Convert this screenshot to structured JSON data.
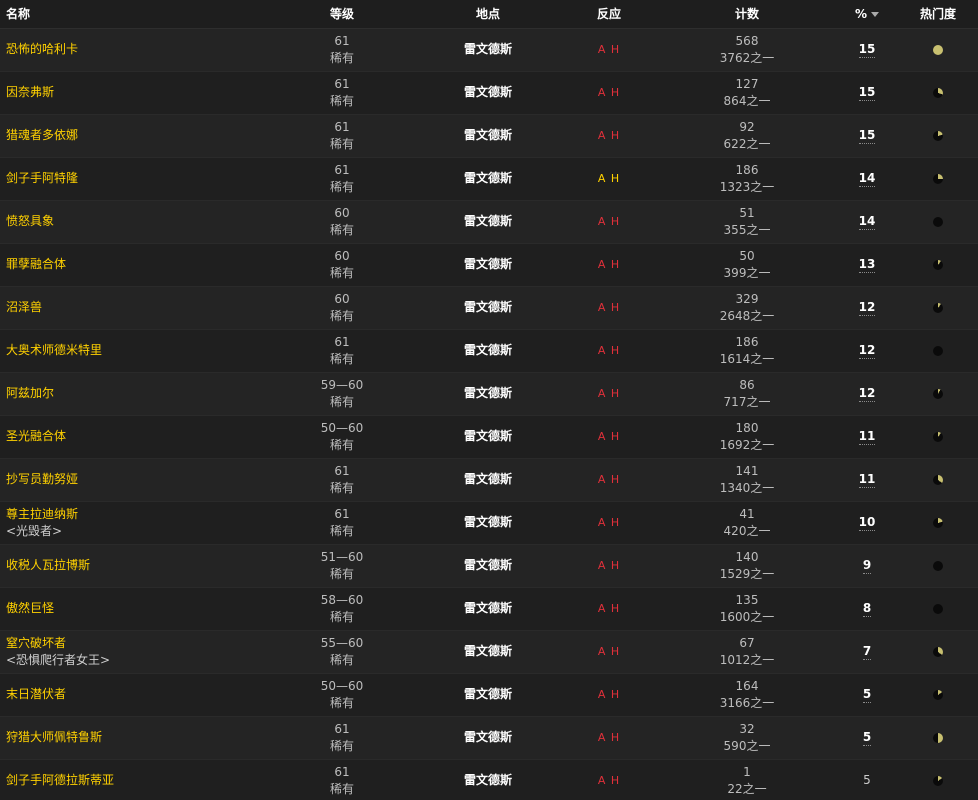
{
  "headers": {
    "name": "名称",
    "level": "等级",
    "location": "地点",
    "reaction": "反应",
    "count": "计数",
    "percent": "%",
    "popularity": "热门度"
  },
  "colors": {
    "name": "#ffd100",
    "reaction_hostile": "#e0303a",
    "reaction_neutral": "#ffd100",
    "pie_fill": "#c8c070",
    "pie_bg": "#0a0a0a"
  },
  "rows": [
    {
      "name": "恐怖的哈利卡",
      "title": "",
      "level": "61",
      "classification": "稀有",
      "location": "雷文德斯",
      "reaction": "A H",
      "reaction_color": "#e0303a",
      "count": "568",
      "total": "3762之一",
      "percent": "15",
      "percent_style": "dotted",
      "popularity": 1.0
    },
    {
      "name": "因奈弗斯",
      "title": "",
      "level": "61",
      "classification": "稀有",
      "location": "雷文德斯",
      "reaction": "A H",
      "reaction_color": "#e0303a",
      "count": "127",
      "total": "864之一",
      "percent": "15",
      "percent_style": "dotted",
      "popularity": 0.3
    },
    {
      "name": "猎魂者多依娜",
      "title": "",
      "level": "61",
      "classification": "稀有",
      "location": "雷文德斯",
      "reaction": "A H",
      "reaction_color": "#e0303a",
      "count": "92",
      "total": "622之一",
      "percent": "15",
      "percent_style": "dotted",
      "popularity": 0.2
    },
    {
      "name": "剑子手阿特隆",
      "title": "",
      "level": "61",
      "classification": "稀有",
      "location": "雷文德斯",
      "reaction": "A H",
      "reaction_color": "#ffd100",
      "count": "186",
      "total": "1323之一",
      "percent": "14",
      "percent_style": "dotted",
      "popularity": 0.25
    },
    {
      "name": "愤怒具象",
      "title": "",
      "level": "60",
      "classification": "稀有",
      "location": "雷文德斯",
      "reaction": "A H",
      "reaction_color": "#e0303a",
      "count": "51",
      "total": "355之一",
      "percent": "14",
      "percent_style": "dotted",
      "popularity": 0.0
    },
    {
      "name": "罪孽融合体",
      "title": "",
      "level": "60",
      "classification": "稀有",
      "location": "雷文德斯",
      "reaction": "A H",
      "reaction_color": "#e0303a",
      "count": "50",
      "total": "399之一",
      "percent": "13",
      "percent_style": "dotted",
      "popularity": 0.1
    },
    {
      "name": "沼泽兽",
      "title": "",
      "level": "60",
      "classification": "稀有",
      "location": "雷文德斯",
      "reaction": "A H",
      "reaction_color": "#e0303a",
      "count": "329",
      "total": "2648之一",
      "percent": "12",
      "percent_style": "dotted",
      "popularity": 0.1
    },
    {
      "name": "大奥术师德米特里",
      "title": "",
      "level": "61",
      "classification": "稀有",
      "location": "雷文德斯",
      "reaction": "A H",
      "reaction_color": "#e0303a",
      "count": "186",
      "total": "1614之一",
      "percent": "12",
      "percent_style": "dotted",
      "popularity": 0.0
    },
    {
      "name": "阿兹加尔",
      "title": "",
      "level": "59—60",
      "classification": "稀有",
      "location": "雷文德斯",
      "reaction": "A H",
      "reaction_color": "#e0303a",
      "count": "86",
      "total": "717之一",
      "percent": "12",
      "percent_style": "dotted",
      "popularity": 0.08
    },
    {
      "name": "圣光融合体",
      "title": "",
      "level": "50—60",
      "classification": "稀有",
      "location": "雷文德斯",
      "reaction": "A H",
      "reaction_color": "#e0303a",
      "count": "180",
      "total": "1692之一",
      "percent": "11",
      "percent_style": "dotted",
      "popularity": 0.1
    },
    {
      "name": "抄写员勤努娅",
      "title": "",
      "level": "61",
      "classification": "稀有",
      "location": "雷文德斯",
      "reaction": "A H",
      "reaction_color": "#e0303a",
      "count": "141",
      "total": "1340之一",
      "percent": "11",
      "percent_style": "dotted",
      "popularity": 0.35
    },
    {
      "name": "尊主拉迪纳斯",
      "title": "<光毁者>",
      "level": "61",
      "classification": "稀有",
      "location": "雷文德斯",
      "reaction": "A H",
      "reaction_color": "#e0303a",
      "count": "41",
      "total": "420之一",
      "percent": "10",
      "percent_style": "dotted",
      "popularity": 0.2
    },
    {
      "name": "收税人瓦拉博斯",
      "title": "",
      "level": "51—60",
      "classification": "稀有",
      "location": "雷文德斯",
      "reaction": "A H",
      "reaction_color": "#e0303a",
      "count": "140",
      "total": "1529之一",
      "percent": "9",
      "percent_style": "dotted",
      "popularity": 0.0
    },
    {
      "name": "傲然巨怪",
      "title": "",
      "level": "58—60",
      "classification": "稀有",
      "location": "雷文德斯",
      "reaction": "A H",
      "reaction_color": "#e0303a",
      "count": "135",
      "total": "1600之一",
      "percent": "8",
      "percent_style": "dotted",
      "popularity": 0.0
    },
    {
      "name": "窒穴破坏者",
      "title": "<恐惧爬行者女王>",
      "level": "55—60",
      "classification": "稀有",
      "location": "雷文德斯",
      "reaction": "A H",
      "reaction_color": "#e0303a",
      "count": "67",
      "total": "1012之一",
      "percent": "7",
      "percent_style": "dotted",
      "popularity": 0.35
    },
    {
      "name": "末日潜伏者",
      "title": "",
      "level": "50—60",
      "classification": "稀有",
      "location": "雷文德斯",
      "reaction": "A H",
      "reaction_color": "#e0303a",
      "count": "164",
      "total": "3166之一",
      "percent": "5",
      "percent_style": "dotted",
      "popularity": 0.15
    },
    {
      "name": "狩猎大师佩特鲁斯",
      "title": "",
      "level": "61",
      "classification": "稀有",
      "location": "雷文德斯",
      "reaction": "A H",
      "reaction_color": "#e0303a",
      "count": "32",
      "total": "590之一",
      "percent": "5",
      "percent_style": "dotted",
      "popularity": 0.5
    },
    {
      "name": "剑子手阿德拉斯蒂亚",
      "title": "",
      "level": "61",
      "classification": "稀有",
      "location": "雷文德斯",
      "reaction": "A H",
      "reaction_color": "#e0303a",
      "count": "1",
      "total": "22之一",
      "percent": "5",
      "percent_style": "plain",
      "popularity": 0.15
    }
  ]
}
